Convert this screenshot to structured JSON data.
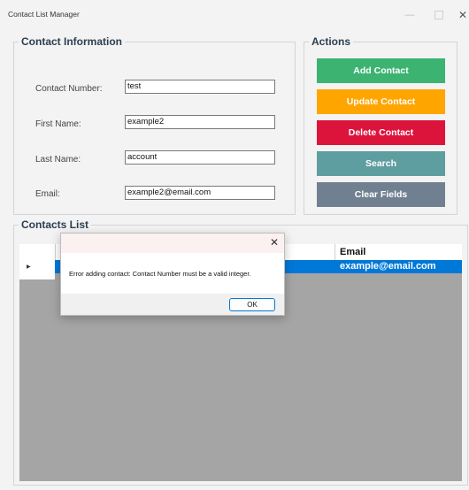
{
  "window": {
    "title": "Contact List Manager"
  },
  "contact_info": {
    "title": "Contact Information",
    "fields": [
      {
        "label": "Contact Number:",
        "value": "test"
      },
      {
        "label": "First Name:",
        "value": "example2"
      },
      {
        "label": "Last Name:",
        "value": "account"
      },
      {
        "label": "Email:",
        "value": "example2@email.com"
      }
    ]
  },
  "actions": {
    "title": "Actions",
    "buttons": [
      {
        "label": "Add Contact",
        "color": "#3cb371"
      },
      {
        "label": "Update Contact",
        "color": "#ffa500"
      },
      {
        "label": "Delete Contact",
        "color": "#dc143c"
      },
      {
        "label": "Search",
        "color": "#5f9ea0"
      },
      {
        "label": "Clear Fields",
        "color": "#708090"
      }
    ]
  },
  "contacts_list": {
    "title": "Contacts List",
    "columns": {
      "email": "Email"
    },
    "selected_row": {
      "email": "example@email.com"
    }
  },
  "dialog": {
    "message": "Error adding contact: Contact Number must be a valid integer.",
    "ok_label": "OK"
  }
}
